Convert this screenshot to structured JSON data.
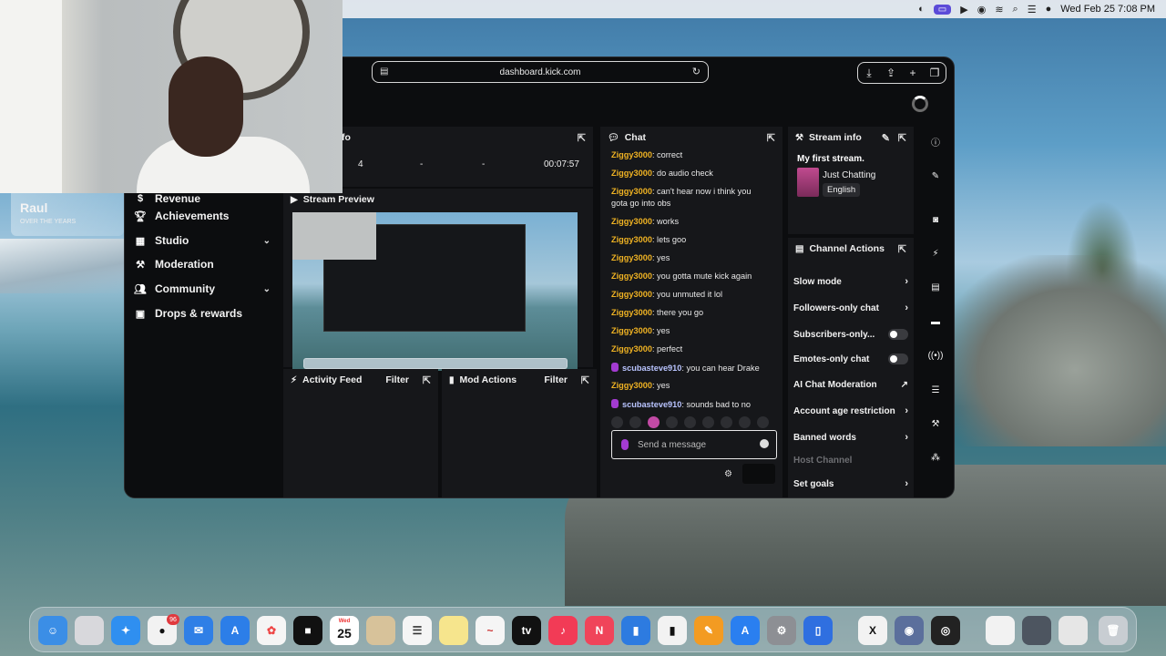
{
  "menubar": {
    "datetime": "Wed Feb 25  7:08 PM"
  },
  "overlay": {
    "user_name": "Raul",
    "user_sub": "OVER THE YEARS"
  },
  "browser": {
    "url": "dashboard.kick.com"
  },
  "nav": {
    "items": [
      {
        "label": "Revenue",
        "icon": "dollar-icon"
      },
      {
        "label": "Achievements",
        "icon": "trophy-icon"
      },
      {
        "label": "Studio",
        "icon": "film-icon"
      },
      {
        "label": "Moderation",
        "icon": "wrench-icon"
      },
      {
        "label": "Community",
        "icon": "users-icon"
      },
      {
        "label": "Drops & rewards",
        "icon": "gift-icon"
      }
    ]
  },
  "session": {
    "title_partial": "fo",
    "stat1": "4",
    "stat2": "-",
    "stat3": "-",
    "uptime": "00:07:57"
  },
  "preview": {
    "title": "Stream Preview"
  },
  "activity": {
    "title": "Activity Feed",
    "filter": "Filter"
  },
  "mod_actions": {
    "title": "Mod Actions",
    "filter": "Filter"
  },
  "chat": {
    "title": "Chat",
    "messages": [
      {
        "user": "Ziggy3000",
        "text": "correct",
        "badge": false
      },
      {
        "user": "Ziggy3000",
        "text": "do audio check",
        "badge": false
      },
      {
        "user": "Ziggy3000",
        "text": "can't hear now i think you",
        "badge": false
      },
      {
        "user": "",
        "text": "gota go into obs",
        "badge": false
      },
      {
        "user": "Ziggy3000",
        "text": "works",
        "badge": false
      },
      {
        "user": "Ziggy3000",
        "text": "lets goo",
        "badge": false
      },
      {
        "user": "Ziggy3000",
        "text": "yes",
        "badge": false
      },
      {
        "user": "Ziggy3000",
        "text": "you gotta mute kick again",
        "badge": false
      },
      {
        "user": "Ziggy3000",
        "text": "you unmuted it lol",
        "badge": false
      },
      {
        "user": "Ziggy3000",
        "text": "there you go",
        "badge": false
      },
      {
        "user": "Ziggy3000",
        "text": "yes",
        "badge": false
      },
      {
        "user": "Ziggy3000",
        "text": "perfect",
        "badge": false
      },
      {
        "user": "scubasteve910",
        "text": "you can hear Drake",
        "badge": true
      },
      {
        "user": "Ziggy3000",
        "text": "yes",
        "badge": false
      },
      {
        "user": "scubasteve910",
        "text": "sounds bad to no",
        "badge": true
      }
    ],
    "input_placeholder": "Send a message"
  },
  "stream_info": {
    "title": "Stream info",
    "stream_title": "My first stream.",
    "category": "Just Chatting",
    "language": "English"
  },
  "channel_actions": {
    "title": "Channel Actions",
    "items": [
      {
        "label": "Slow mode",
        "control": "arrow"
      },
      {
        "label": "Followers-only chat",
        "control": "arrow"
      },
      {
        "label": "Subscribers-only...",
        "control": "toggle"
      },
      {
        "label": "Emotes-only chat",
        "control": "toggle"
      },
      {
        "label": "AI Chat Moderation",
        "control": "external"
      },
      {
        "label": "Account age restriction",
        "control": "arrow"
      },
      {
        "label": "Banned words",
        "control": "arrow"
      },
      {
        "label": "Host Channel",
        "control": "none"
      },
      {
        "label": "Set goals",
        "control": "arrow"
      }
    ]
  },
  "dock": {
    "calendar_weekday": "Wed",
    "calendar_day": "25",
    "messages_badge": "96"
  }
}
